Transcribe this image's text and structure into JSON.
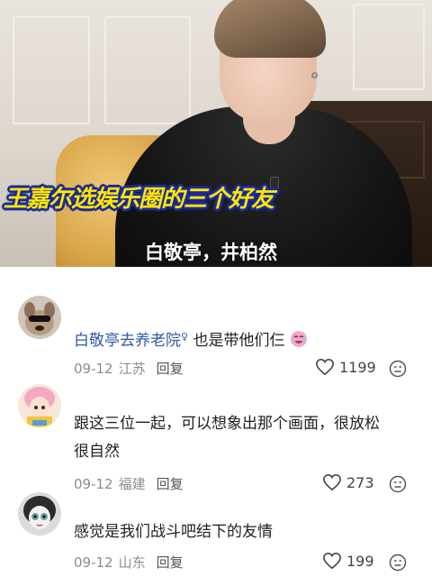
{
  "video": {
    "caption_main": "王嘉尔选娱乐圈的三个好友",
    "caption_sub": "白敬亭，井柏然"
  },
  "comments": [
    {
      "username": "白敬亭去养老院",
      "name_icon": "female-symbol-icon",
      "text": "也是带他们仨",
      "trailing_emoji": "laughing-face-emoji-icon",
      "date": "09-12",
      "location": "江苏",
      "reply_label": "回复",
      "likes": "1199"
    },
    {
      "username": "",
      "text_line1": "跟这三位一起，可以想象出那个画面，很放松",
      "text_line2": "很自然",
      "date": "09-12",
      "location": "福建",
      "reply_label": "回复",
      "likes": "273"
    },
    {
      "username": "",
      "text": "感觉是我们战斗吧结下的友情",
      "date": "09-12",
      "location": "山东",
      "reply_label": "回复",
      "likes": "199"
    }
  ],
  "colors": {
    "username": "#2f5aa8",
    "meta": "#8c8c8c",
    "caption_yellow": "#ffe600",
    "caption_outline": "#1a2a9a"
  }
}
